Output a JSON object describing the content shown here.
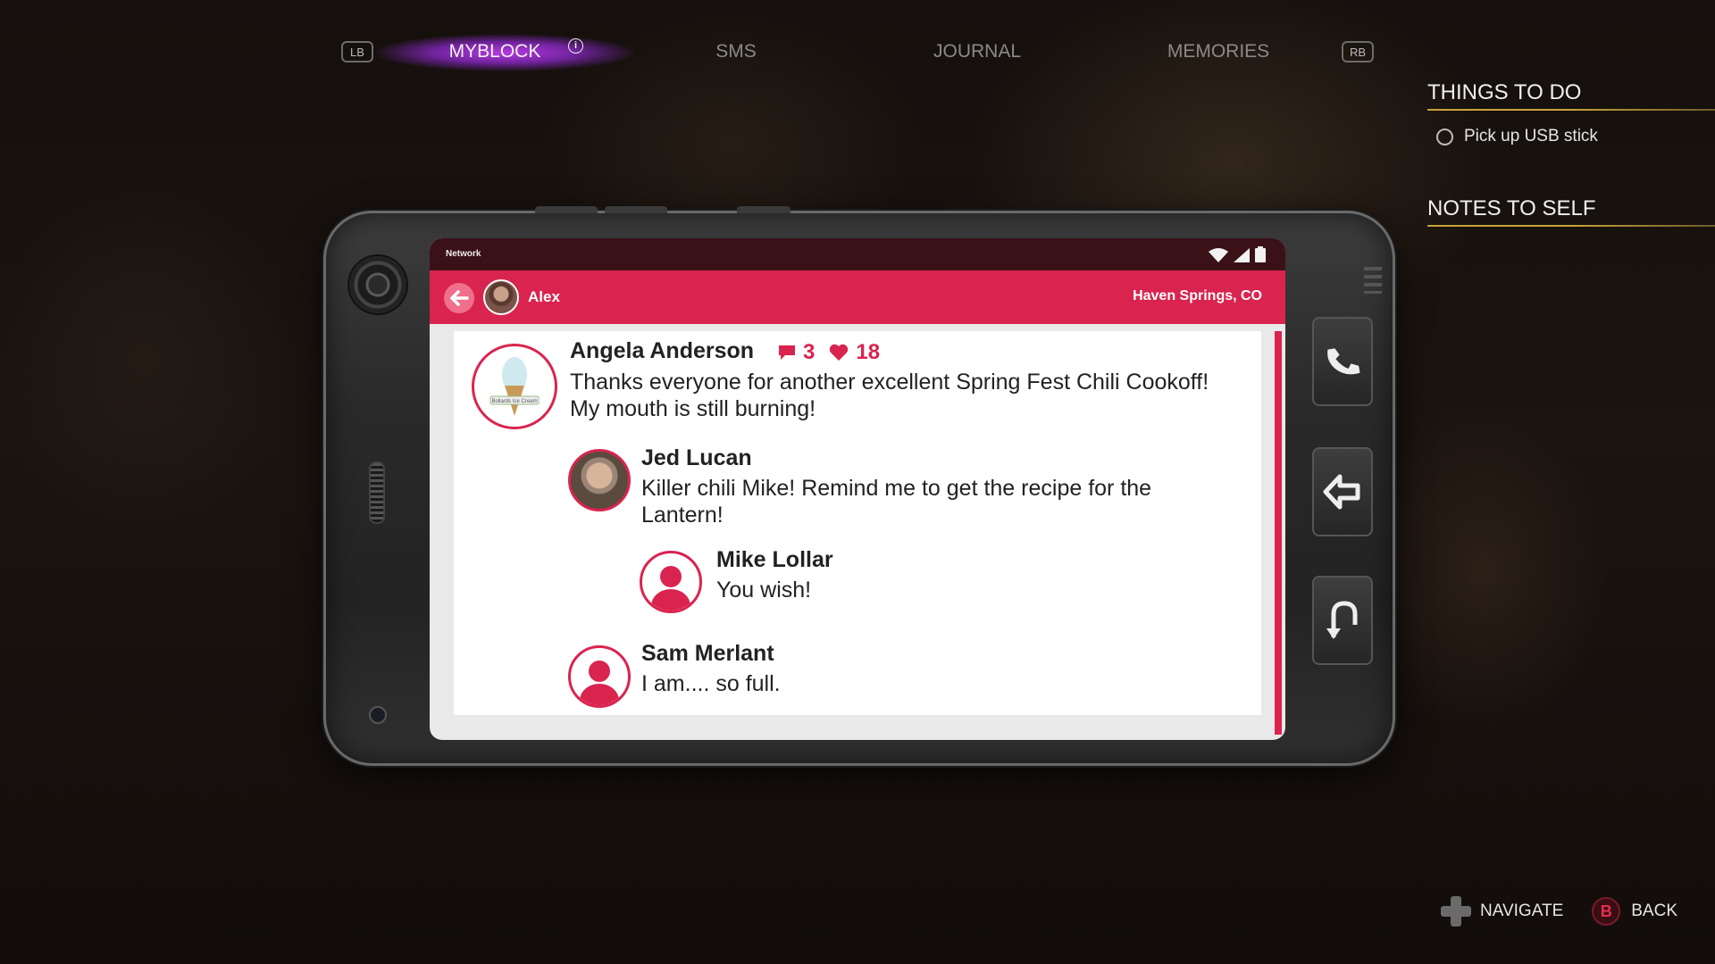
{
  "tabs": {
    "left_button": "LB",
    "right_button": "RB",
    "items": [
      {
        "label": "MYBLOCK",
        "active": true
      },
      {
        "label": "SMS",
        "active": false
      },
      {
        "label": "JOURNAL",
        "active": false
      },
      {
        "label": "MEMORIES",
        "active": false
      }
    ],
    "info_glyph": "i"
  },
  "side_panel": {
    "things_to_do_title": "THINGS TO DO",
    "tasks": [
      {
        "label": "Pick up USB stick",
        "done": false
      }
    ],
    "notes_title": "NOTES TO SELF"
  },
  "phone": {
    "status_bar": {
      "network_label": "Network"
    },
    "app_bar": {
      "user_name": "Alex",
      "location": "Haven Springs, CO"
    },
    "post": {
      "author": "Angela Anderson",
      "avatar_label": "Bollards Ice Cream",
      "comments": "3",
      "likes": "18",
      "text_line1": "Thanks everyone for another excellent Spring Fest Chili Cookoff!",
      "text_line2": "My mouth is still burning!"
    },
    "replies": [
      {
        "author": "Jed Lucan",
        "text_line1": "Killer chili Mike! Remind me to get the recipe for the",
        "text_line2": "Lantern!"
      },
      {
        "author": "Mike Lollar",
        "text_line1": "You wish!"
      },
      {
        "author": "Sam Merlant",
        "text_line1": "I am.... so full."
      }
    ]
  },
  "hints": {
    "navigate_label": "NAVIGATE",
    "back_button": "B",
    "back_label": "BACK"
  },
  "colors": {
    "accent": "#d9244f",
    "tab_glow": "#b43cf0",
    "underline_gold": "#c9a23a"
  }
}
